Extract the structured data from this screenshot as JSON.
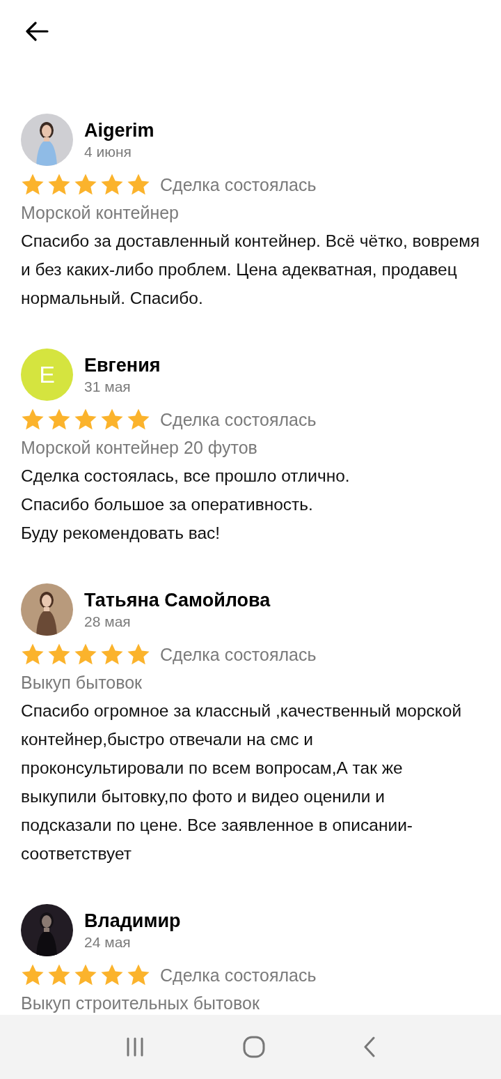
{
  "reviews": [
    {
      "name": "Aigerim",
      "date": "4 июня",
      "stars": 5,
      "status": "Сделка состоялась",
      "category": "Морской контейнер",
      "text": "Спасибо за доставленный контейнер. Всё чётко, вовремя и без каких-либо проблем. Цена адекватная, продавец нормальный. Спасибо."
    },
    {
      "name": "Евгения",
      "date": "31 мая",
      "avatar": {
        "kind": "letter",
        "letter": "E",
        "color": "#d5e43f"
      },
      "stars": 5,
      "status": "Сделка состоялась",
      "category": "Морской контейнер 20 футов",
      "text": "Сделка состоялась, все прошло отлично.\nСпасибо большое за оперативность.\nБуду рекомендовать вас!"
    },
    {
      "name": "Татьяна Самойлова",
      "date": "28 мая",
      "stars": 5,
      "status": "Сделка состоялась",
      "category": "Выкуп бытовок",
      "text": "Спасибо огромное за классный ,качественный морской контейнер,быстро отвечали на смс и проконсультировали по всем вопросам,А так же выкупили бытовку,по фото и видео оценили и подсказали по цене. Все заявленное в описании-соответствует"
    },
    {
      "name": "Владимир",
      "date": "24 мая",
      "stars": 5,
      "status": "Сделка состоялась",
      "category": "Выкуп строительных бытовок"
    }
  ]
}
